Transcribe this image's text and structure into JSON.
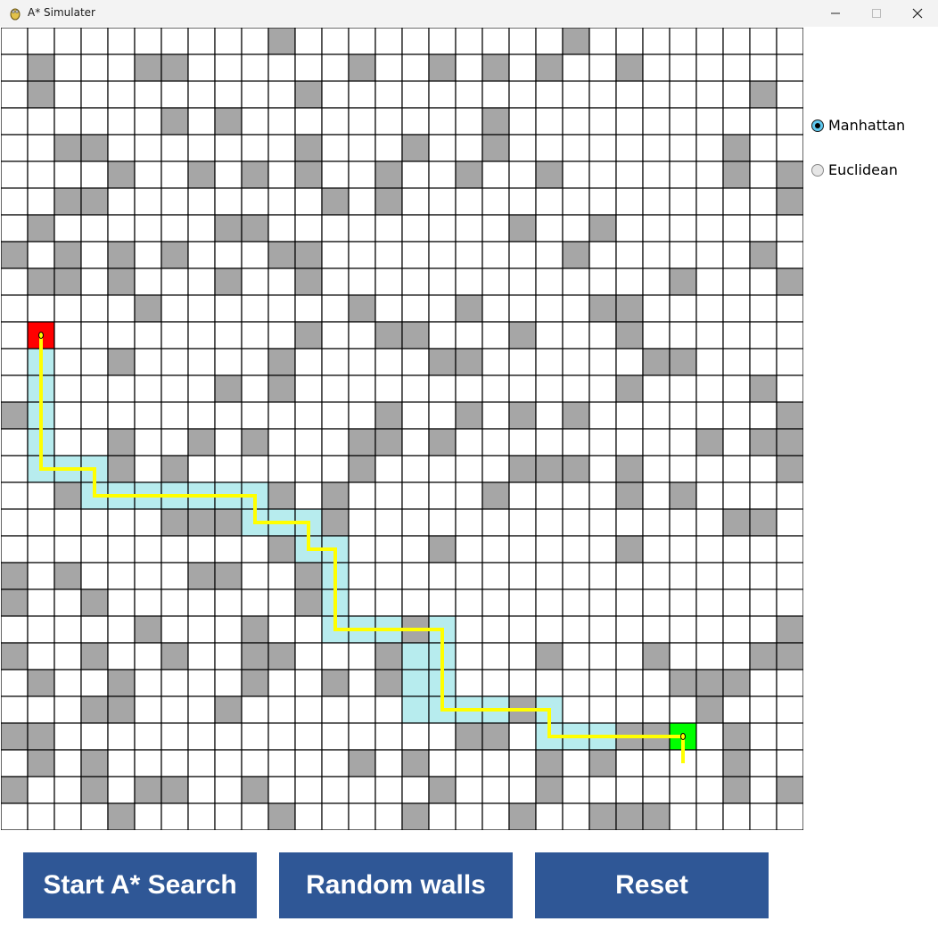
{
  "window": {
    "title": "A* Simulater",
    "icon": "python-snake-icon",
    "controls": [
      "minimize-icon",
      "maximize-icon",
      "close-icon"
    ]
  },
  "grid": {
    "rows": 30,
    "cols": 30,
    "colors": {
      "empty": "#ffffff",
      "wall": "#a6a6a6",
      "start": "#ff0000",
      "end": "#00ff00",
      "visited": "#b7ecee",
      "path": "#ffff00",
      "grid_line": "#000000"
    },
    "walls": [
      [
        0,
        10
      ],
      [
        0,
        21
      ],
      [
        1,
        1
      ],
      [
        1,
        5
      ],
      [
        1,
        6
      ],
      [
        1,
        13
      ],
      [
        1,
        16
      ],
      [
        1,
        18
      ],
      [
        1,
        20
      ],
      [
        1,
        23
      ],
      [
        2,
        1
      ],
      [
        2,
        11
      ],
      [
        2,
        28
      ],
      [
        3,
        6
      ],
      [
        3,
        8
      ],
      [
        3,
        18
      ],
      [
        4,
        2
      ],
      [
        4,
        3
      ],
      [
        4,
        11
      ],
      [
        4,
        15
      ],
      [
        4,
        18
      ],
      [
        4,
        27
      ],
      [
        5,
        4
      ],
      [
        5,
        7
      ],
      [
        5,
        9
      ],
      [
        5,
        11
      ],
      [
        5,
        14
      ],
      [
        5,
        17
      ],
      [
        5,
        20
      ],
      [
        5,
        27
      ],
      [
        5,
        29
      ],
      [
        6,
        2
      ],
      [
        6,
        3
      ],
      [
        6,
        12
      ],
      [
        6,
        14
      ],
      [
        6,
        29
      ],
      [
        7,
        1
      ],
      [
        7,
        8
      ],
      [
        7,
        9
      ],
      [
        7,
        19
      ],
      [
        7,
        22
      ],
      [
        8,
        0
      ],
      [
        8,
        2
      ],
      [
        8,
        4
      ],
      [
        8,
        6
      ],
      [
        8,
        10
      ],
      [
        8,
        11
      ],
      [
        8,
        21
      ],
      [
        8,
        28
      ],
      [
        9,
        1
      ],
      [
        9,
        2
      ],
      [
        9,
        4
      ],
      [
        9,
        8
      ],
      [
        9,
        11
      ],
      [
        9,
        25
      ],
      [
        9,
        29
      ],
      [
        10,
        5
      ],
      [
        10,
        13
      ],
      [
        10,
        17
      ],
      [
        10,
        22
      ],
      [
        10,
        23
      ],
      [
        11,
        11
      ],
      [
        11,
        14
      ],
      [
        11,
        15
      ],
      [
        11,
        19
      ],
      [
        11,
        23
      ],
      [
        12,
        4
      ],
      [
        12,
        10
      ],
      [
        12,
        16
      ],
      [
        12,
        17
      ],
      [
        12,
        24
      ],
      [
        12,
        25
      ],
      [
        13,
        8
      ],
      [
        13,
        10
      ],
      [
        13,
        23
      ],
      [
        13,
        28
      ],
      [
        14,
        0
      ],
      [
        14,
        14
      ],
      [
        14,
        17
      ],
      [
        14,
        19
      ],
      [
        14,
        21
      ],
      [
        14,
        29
      ],
      [
        15,
        4
      ],
      [
        15,
        7
      ],
      [
        15,
        9
      ],
      [
        15,
        13
      ],
      [
        15,
        14
      ],
      [
        15,
        16
      ],
      [
        15,
        26
      ],
      [
        15,
        28
      ],
      [
        15,
        29
      ],
      [
        16,
        4
      ],
      [
        16,
        6
      ],
      [
        16,
        13
      ],
      [
        16,
        19
      ],
      [
        16,
        20
      ],
      [
        16,
        21
      ],
      [
        16,
        23
      ],
      [
        16,
        29
      ],
      [
        17,
        2
      ],
      [
        17,
        10
      ],
      [
        17,
        12
      ],
      [
        17,
        18
      ],
      [
        17,
        23
      ],
      [
        17,
        25
      ],
      [
        18,
        6
      ],
      [
        18,
        7
      ],
      [
        18,
        8
      ],
      [
        18,
        12
      ],
      [
        18,
        27
      ],
      [
        18,
        28
      ],
      [
        19,
        10
      ],
      [
        19,
        16
      ],
      [
        19,
        23
      ],
      [
        20,
        0
      ],
      [
        20,
        2
      ],
      [
        20,
        7
      ],
      [
        20,
        8
      ],
      [
        20,
        11
      ],
      [
        21,
        0
      ],
      [
        21,
        3
      ],
      [
        21,
        11
      ],
      [
        22,
        5
      ],
      [
        22,
        9
      ],
      [
        22,
        15
      ],
      [
        22,
        29
      ],
      [
        23,
        0
      ],
      [
        23,
        3
      ],
      [
        23,
        6
      ],
      [
        23,
        9
      ],
      [
        23,
        10
      ],
      [
        23,
        14
      ],
      [
        23,
        20
      ],
      [
        23,
        24
      ],
      [
        23,
        28
      ],
      [
        23,
        29
      ],
      [
        24,
        1
      ],
      [
        24,
        4
      ],
      [
        24,
        9
      ],
      [
        24,
        12
      ],
      [
        24,
        14
      ],
      [
        24,
        25
      ],
      [
        24,
        26
      ],
      [
        24,
        27
      ],
      [
        25,
        3
      ],
      [
        25,
        4
      ],
      [
        25,
        8
      ],
      [
        25,
        19
      ],
      [
        25,
        26
      ],
      [
        26,
        0
      ],
      [
        26,
        1
      ],
      [
        26,
        17
      ],
      [
        26,
        18
      ],
      [
        26,
        23
      ],
      [
        26,
        24
      ],
      [
        26,
        27
      ],
      [
        27,
        1
      ],
      [
        27,
        3
      ],
      [
        27,
        13
      ],
      [
        27,
        15
      ],
      [
        27,
        20
      ],
      [
        27,
        22
      ],
      [
        27,
        27
      ],
      [
        28,
        0
      ],
      [
        28,
        3
      ],
      [
        28,
        5
      ],
      [
        28,
        6
      ],
      [
        28,
        9
      ],
      [
        28,
        16
      ],
      [
        28,
        20
      ],
      [
        28,
        27
      ],
      [
        28,
        29
      ],
      [
        29,
        4
      ],
      [
        29,
        10
      ],
      [
        29,
        15
      ],
      [
        29,
        19
      ],
      [
        29,
        22
      ],
      [
        29,
        23
      ],
      [
        29,
        24
      ]
    ],
    "start": [
      11,
      1
    ],
    "end": [
      26,
      25
    ],
    "path": [
      [
        11,
        1
      ],
      [
        12,
        1
      ],
      [
        13,
        1
      ],
      [
        14,
        1
      ],
      [
        15,
        1
      ],
      [
        16,
        1
      ],
      [
        16,
        2
      ],
      [
        16,
        3
      ],
      [
        17,
        3
      ],
      [
        17,
        4
      ],
      [
        17,
        5
      ],
      [
        17,
        6
      ],
      [
        17,
        7
      ],
      [
        17,
        8
      ],
      [
        17,
        9
      ],
      [
        18,
        9
      ],
      [
        18,
        10
      ],
      [
        18,
        11
      ],
      [
        19,
        11
      ],
      [
        19,
        12
      ],
      [
        20,
        12
      ],
      [
        21,
        12
      ],
      [
        22,
        12
      ],
      [
        22,
        13
      ],
      [
        22,
        14
      ],
      [
        22,
        15
      ],
      [
        22,
        16
      ],
      [
        23,
        16
      ],
      [
        24,
        16
      ],
      [
        25,
        16
      ],
      [
        25,
        17
      ],
      [
        25,
        18
      ],
      [
        25,
        19
      ],
      [
        25,
        20
      ],
      [
        26,
        20
      ],
      [
        26,
        21
      ],
      [
        26,
        22
      ],
      [
        26,
        23
      ],
      [
        26,
        24
      ],
      [
        26,
        25
      ],
      [
        27,
        25
      ]
    ],
    "visited": [
      [
        11,
        1
      ],
      [
        12,
        1
      ],
      [
        13,
        1
      ],
      [
        14,
        1
      ],
      [
        15,
        1
      ],
      [
        16,
        1
      ],
      [
        16,
        2
      ],
      [
        16,
        3
      ],
      [
        17,
        3
      ],
      [
        17,
        4
      ],
      [
        17,
        5
      ],
      [
        17,
        6
      ],
      [
        17,
        7
      ],
      [
        17,
        8
      ],
      [
        17,
        9
      ],
      [
        18,
        9
      ],
      [
        18,
        10
      ],
      [
        18,
        11
      ],
      [
        19,
        11
      ],
      [
        19,
        12
      ],
      [
        20,
        12
      ],
      [
        21,
        12
      ],
      [
        22,
        12
      ],
      [
        22,
        13
      ],
      [
        22,
        14
      ],
      [
        22,
        15
      ],
      [
        22,
        16
      ],
      [
        23,
        15
      ],
      [
        24,
        15
      ],
      [
        25,
        15
      ],
      [
        23,
        16
      ],
      [
        24,
        16
      ],
      [
        25,
        16
      ],
      [
        25,
        17
      ],
      [
        25,
        18
      ],
      [
        25,
        19
      ],
      [
        25,
        20
      ],
      [
        26,
        20
      ],
      [
        26,
        21
      ],
      [
        26,
        22
      ],
      [
        26,
        23
      ],
      [
        26,
        24
      ],
      [
        26,
        25
      ]
    ]
  },
  "heuristics": {
    "options": [
      {
        "label": "Manhattan",
        "checked": true
      },
      {
        "label": "Euclidean",
        "checked": false
      }
    ]
  },
  "buttons": {
    "start_label": "Start A* Search",
    "random_label": "Random walls",
    "reset_label": "Reset",
    "color": "#2f5796"
  }
}
